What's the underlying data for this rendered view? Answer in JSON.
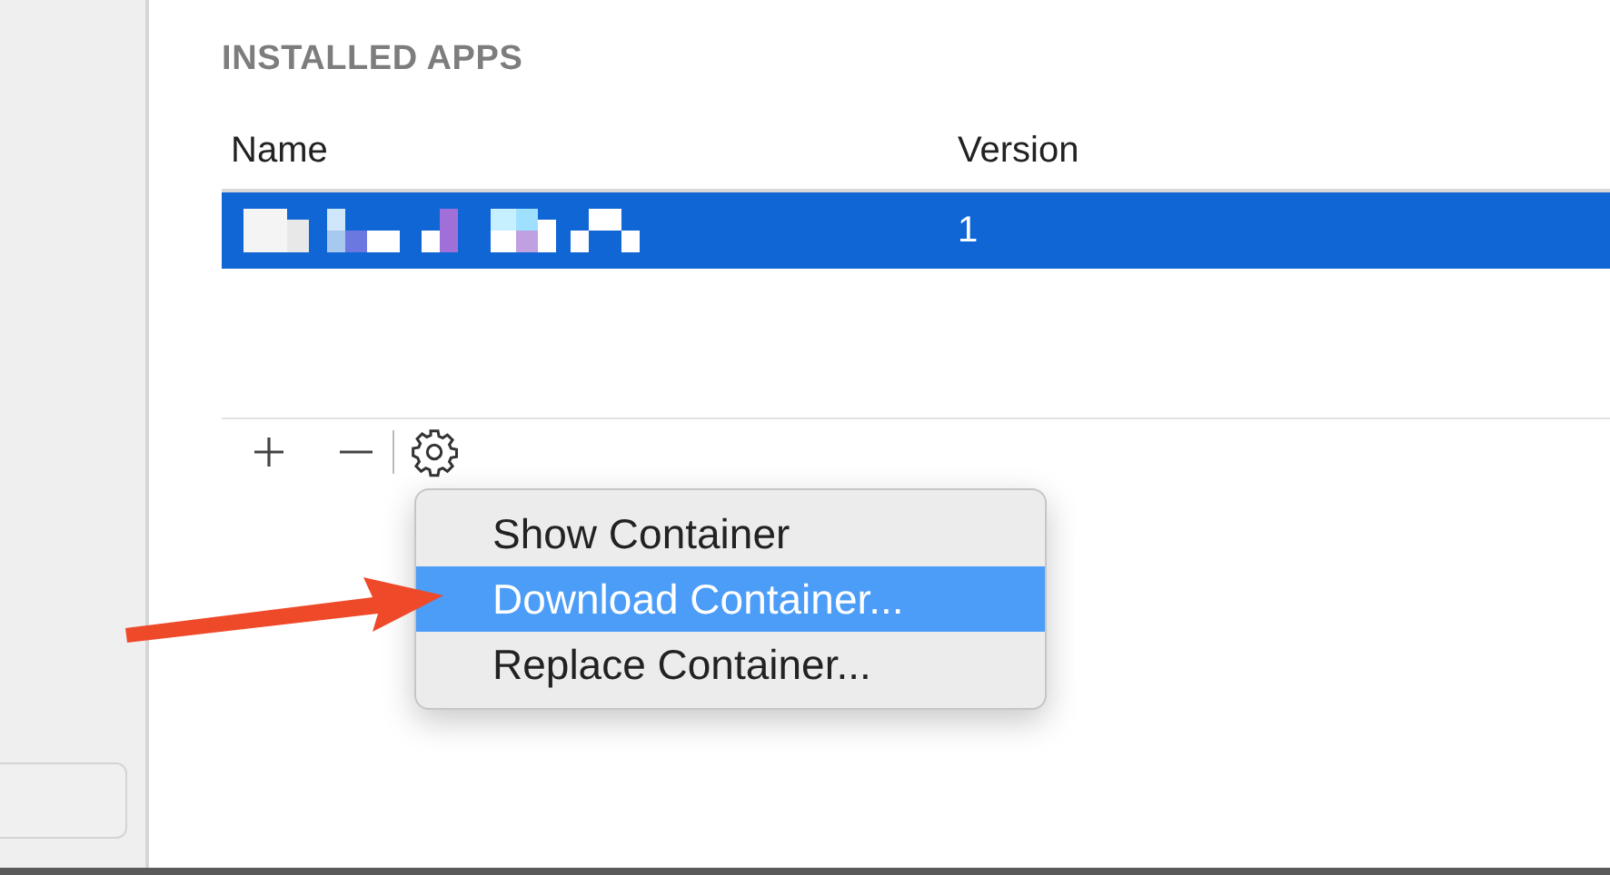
{
  "section_title": "INSTALLED APPS",
  "table": {
    "columns": [
      "Name",
      "Version"
    ],
    "rows": [
      {
        "version": "1",
        "selected": true
      }
    ]
  },
  "menu": {
    "items": [
      {
        "label": "Show Container",
        "selected": false
      },
      {
        "label": "Download Container...",
        "selected": true
      },
      {
        "label": "Replace Container...",
        "selected": false
      }
    ]
  }
}
